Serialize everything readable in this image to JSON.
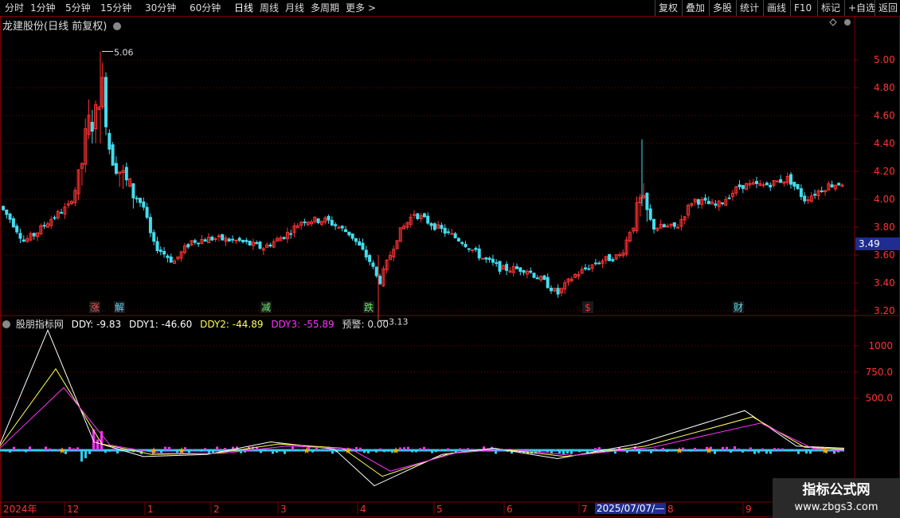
{
  "toolbar": {
    "periods": [
      "分时",
      "1分钟",
      "5分钟",
      "15分钟",
      "30分钟",
      "60分钟",
      "日线",
      "周线",
      "月线",
      "多周期",
      "更多"
    ],
    "active": "日线",
    "actions": [
      "复权",
      "叠加",
      "多股",
      "统计",
      "画线",
      "F10",
      "标记",
      "+自选",
      "返回"
    ]
  },
  "stock": {
    "title": "龙建股份(日线 前复权)"
  },
  "price_axis": {
    "ticks": [
      "5.00",
      "4.80",
      "4.60",
      "4.40",
      "4.20",
      "4.00",
      "3.80",
      "3.60",
      "3.40",
      "3.20"
    ]
  },
  "last_price": "3.49",
  "annotations": {
    "high_label": "5.06",
    "low_label": "3.13"
  },
  "event_markers": [
    "涨",
    "解",
    "减",
    "跌",
    "$",
    "财"
  ],
  "indicator": {
    "name": "股朋指标网",
    "values": [
      {
        "label": "DDY: -9.83",
        "color": "#ffffff"
      },
      {
        "label": "DDY1: -46.60",
        "color": "#ffffff"
      },
      {
        "label": "DDY2: -44.89",
        "color": "#ffff55"
      },
      {
        "label": "DDY3: -55.89",
        "color": "#ff33ff"
      },
      {
        "label": "预警: 0.00",
        "color": "#dddddd"
      }
    ],
    "axis_ticks": [
      "1000",
      "750.0",
      "500.0"
    ]
  },
  "date_axis": {
    "labels": [
      "2024年",
      "12",
      "1",
      "2",
      "3",
      "4",
      "5",
      "6",
      "7",
      "8",
      "9"
    ],
    "cursor_date": "2025/07/07/—"
  },
  "watermark": {
    "line1": "指标公式网",
    "line2": "www.zbgs3.com"
  },
  "colors": {
    "up": "#ff3333",
    "down": "#44ddee",
    "grid": "#7a0000",
    "ddy": "#ffffff",
    "ddy2": "#ffff55",
    "ddy3": "#ff33ff"
  },
  "chart_data": [
    {
      "type": "candlestick",
      "title": "龙建股份(日线 前复权)",
      "x": [
        "2024-11",
        "2024-12",
        "2025-01",
        "2025-02",
        "2025-03",
        "2025-04",
        "2025-05",
        "2025-06",
        "2025-07",
        "2025-08",
        "2025-09"
      ],
      "close": [
        3.9,
        4.6,
        3.75,
        3.72,
        3.75,
        3.55,
        3.85,
        3.5,
        3.55,
        3.85,
        4.12
      ],
      "high_point": 5.06,
      "low_point": 3.13,
      "last": 3.49,
      "ylim": [
        3.1,
        5.1
      ]
    },
    {
      "type": "line",
      "title": "股朋指标网",
      "series": [
        {
          "name": "DDY",
          "values": [
            60,
            1150,
            80,
            -60,
            -40,
            80,
            10,
            -340,
            -40,
            20,
            -80,
            60,
            380,
            40,
            20
          ]
        },
        {
          "name": "DDY2",
          "values": [
            40,
            780,
            60,
            -40,
            -30,
            60,
            20,
            -250,
            -30,
            10,
            -60,
            40,
            320,
            30,
            10
          ]
        },
        {
          "name": "DDY3",
          "values": [
            20,
            600,
            50,
            -30,
            -30,
            40,
            15,
            -200,
            -20,
            10,
            -50,
            30,
            260,
            20,
            -10
          ]
        }
      ],
      "ylim": [
        -400,
        1200
      ]
    }
  ]
}
